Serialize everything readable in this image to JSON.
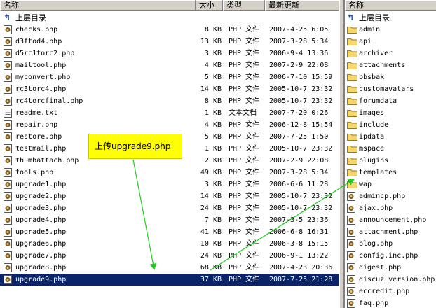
{
  "left_header": {
    "name": "名称",
    "size": "大小",
    "type": "类型",
    "date": "最新更新"
  },
  "right_header": {
    "name": "名称"
  },
  "parent_dir_label": "上层目录",
  "callout": "上传upgrade9.php",
  "left_files": [
    {
      "name": "checks.php",
      "size": "8 KB",
      "type": "PHP 文件",
      "date": "2007-4-25 6:05",
      "icon": "php-file-icon"
    },
    {
      "name": "d3ftod4.php",
      "size": "13 KB",
      "type": "PHP 文件",
      "date": "2007-3-28 5:34",
      "icon": "php-file-icon"
    },
    {
      "name": "d5rc1torc2.php",
      "size": "3 KB",
      "type": "PHP 文件",
      "date": "2006-9-4 13:36",
      "icon": "php-file-icon"
    },
    {
      "name": "mailtool.php",
      "size": "4 KB",
      "type": "PHP 文件",
      "date": "2007-2-9 22:08",
      "icon": "php-file-icon"
    },
    {
      "name": "myconvert.php",
      "size": "5 KB",
      "type": "PHP 文件",
      "date": "2006-7-10 15:59",
      "icon": "php-file-icon"
    },
    {
      "name": "rc3torc4.php",
      "size": "14 KB",
      "type": "PHP 文件",
      "date": "2005-10-7 23:32",
      "icon": "php-file-icon"
    },
    {
      "name": "rc4torcfinal.php",
      "size": "8 KB",
      "type": "PHP 文件",
      "date": "2005-10-7 23:32",
      "icon": "php-file-icon"
    },
    {
      "name": "readme.txt",
      "size": "1 KB",
      "type": "文本文档",
      "date": "2007-7-20 0:26",
      "icon": "text-file-icon"
    },
    {
      "name": "repair.php",
      "size": "4 KB",
      "type": "PHP 文件",
      "date": "2006-12-8 15:54",
      "icon": "php-file-icon"
    },
    {
      "name": "restore.php",
      "size": "5 KB",
      "type": "PHP 文件",
      "date": "2007-7-25 1:50",
      "icon": "php-file-icon"
    },
    {
      "name": "testmail.php",
      "size": "1 KB",
      "type": "PHP 文件",
      "date": "2005-10-7 23:32",
      "icon": "php-file-icon"
    },
    {
      "name": "thumbattach.php",
      "size": "2 KB",
      "type": "PHP 文件",
      "date": "2007-2-9 22:08",
      "icon": "php-file-icon"
    },
    {
      "name": "tools.php",
      "size": "49 KB",
      "type": "PHP 文件",
      "date": "2007-3-28 5:34",
      "icon": "php-file-icon"
    },
    {
      "name": "upgrade1.php",
      "size": "3 KB",
      "type": "PHP 文件",
      "date": "2006-6-6 11:28",
      "icon": "php-file-icon"
    },
    {
      "name": "upgrade2.php",
      "size": "14 KB",
      "type": "PHP 文件",
      "date": "2005-10-7 23:32",
      "icon": "php-file-icon"
    },
    {
      "name": "upgrade3.php",
      "size": "24 KB",
      "type": "PHP 文件",
      "date": "2005-10-7 23:32",
      "icon": "php-file-icon"
    },
    {
      "name": "upgrade4.php",
      "size": "7 KB",
      "type": "PHP 文件",
      "date": "2007-3-5 23:36",
      "icon": "php-file-icon"
    },
    {
      "name": "upgrade5.php",
      "size": "41 KB",
      "type": "PHP 文件",
      "date": "2006-6-8 16:31",
      "icon": "php-file-icon"
    },
    {
      "name": "upgrade6.php",
      "size": "10 KB",
      "type": "PHP 文件",
      "date": "2006-3-8 15:15",
      "icon": "php-file-icon"
    },
    {
      "name": "upgrade7.php",
      "size": "24 KB",
      "type": "PHP 文件",
      "date": "2006-9-1 13:22",
      "icon": "php-file-icon"
    },
    {
      "name": "upgrade8.php",
      "size": "68 KB",
      "type": "PHP 文件",
      "date": "2007-4-23 20:36",
      "icon": "php-file-icon"
    },
    {
      "name": "upgrade9.php",
      "size": "37 KB",
      "type": "PHP 文件",
      "date": "2007-7-25 21:28",
      "icon": "php-file-icon",
      "selected": true
    }
  ],
  "right_items": [
    {
      "name": "admin",
      "kind": "folder"
    },
    {
      "name": "api",
      "kind": "folder"
    },
    {
      "name": "archiver",
      "kind": "folder"
    },
    {
      "name": "attachments",
      "kind": "folder"
    },
    {
      "name": "bbsbak",
      "kind": "folder"
    },
    {
      "name": "customavatars",
      "kind": "folder"
    },
    {
      "name": "forumdata",
      "kind": "folder"
    },
    {
      "name": "images",
      "kind": "folder"
    },
    {
      "name": "include",
      "kind": "folder"
    },
    {
      "name": "ipdata",
      "kind": "folder"
    },
    {
      "name": "mspace",
      "kind": "folder"
    },
    {
      "name": "plugins",
      "kind": "folder"
    },
    {
      "name": "templates",
      "kind": "folder"
    },
    {
      "name": "wap",
      "kind": "folder"
    },
    {
      "name": "admincp.php",
      "kind": "php"
    },
    {
      "name": "ajax.php",
      "kind": "php"
    },
    {
      "name": "announcement.php",
      "kind": "php"
    },
    {
      "name": "attachment.php",
      "kind": "php"
    },
    {
      "name": "blog.php",
      "kind": "php"
    },
    {
      "name": "config.inc.php",
      "kind": "php"
    },
    {
      "name": "digest.php",
      "kind": "php"
    },
    {
      "name": "discuz_version.php",
      "kind": "php"
    },
    {
      "name": "eccredit.php",
      "kind": "php"
    },
    {
      "name": "faq.php",
      "kind": "php"
    }
  ],
  "colors": {
    "selection": "#0a246a",
    "callout": "#ffff00",
    "arrow": "#22cc22",
    "folder": "#f5d76e"
  }
}
